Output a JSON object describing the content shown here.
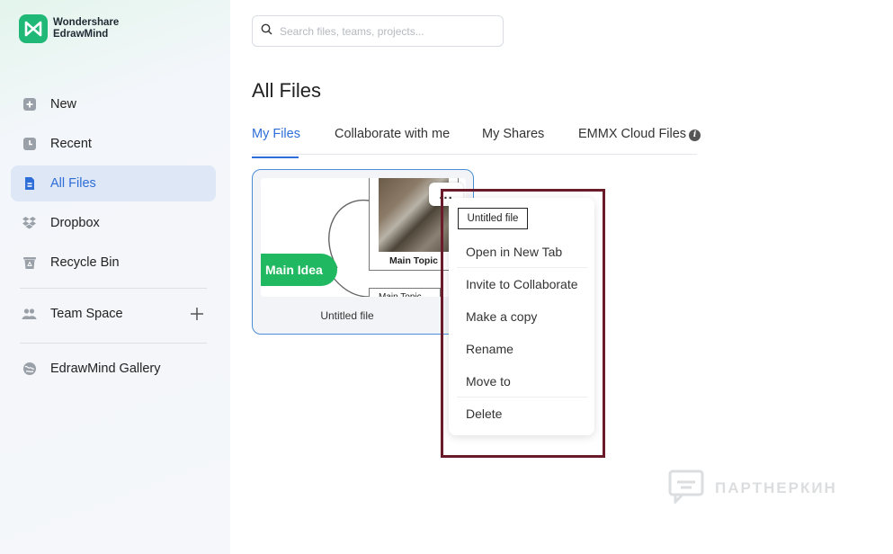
{
  "brand": {
    "line1": "Wondershare",
    "line2": "EdrawMind",
    "color": "#1fb877"
  },
  "sidebar": {
    "items": [
      {
        "label": "New",
        "icon": "new-file-icon"
      },
      {
        "label": "Recent",
        "icon": "clock-icon"
      },
      {
        "label": "All Files",
        "icon": "document-icon",
        "active": true
      },
      {
        "label": "Dropbox",
        "icon": "dropbox-icon"
      },
      {
        "label": "Recycle Bin",
        "icon": "trash-icon"
      }
    ],
    "team_space": {
      "label": "Team Space",
      "icon": "team-icon",
      "action_icon": "plus-icon"
    },
    "gallery": {
      "label": "EdrawMind Gallery",
      "icon": "globe-icon"
    }
  },
  "search": {
    "placeholder": "Search files, teams, projects..."
  },
  "page_title": "All Files",
  "tabs": [
    {
      "label": "My Files",
      "active": true
    },
    {
      "label": "Collaborate with me"
    },
    {
      "label": "My Shares"
    },
    {
      "label": "EMMX Cloud Files",
      "icon": "info-icon"
    }
  ],
  "file_card": {
    "name": "Untitled file",
    "thumbnail": {
      "main_idea": "Main Idea",
      "topic1": "Main Topic",
      "topic2": "Main Topic"
    },
    "more_button": "..."
  },
  "context_menu": {
    "tooltip": "Untitled file",
    "items": [
      "Open in New Tab",
      "Invite to Collaborate",
      "Make a copy",
      "Rename",
      "Move to",
      "Delete"
    ]
  },
  "watermark": "ПАРТНЕРКИН",
  "colors": {
    "accent": "#2e6ed8",
    "brand_green": "#1fb877",
    "frame": "#6b1a2a",
    "active_bg": "#dde7f5"
  }
}
